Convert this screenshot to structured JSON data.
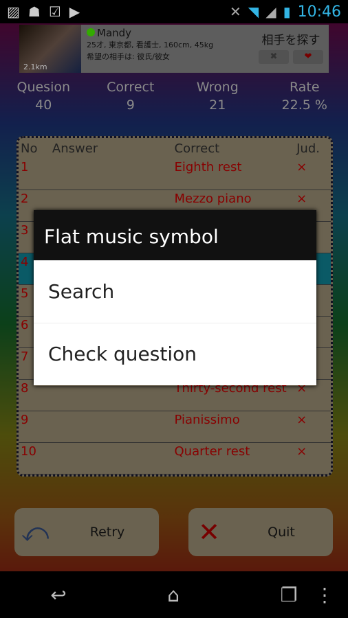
{
  "status_bar": {
    "time": "10:46",
    "icons": [
      "picture-icon",
      "android-icon",
      "clipboard-check-icon",
      "play-store-icon",
      "mute-icon",
      "wifi-icon",
      "signal-icon",
      "battery-icon"
    ]
  },
  "ad": {
    "distance": "2.1km",
    "name": "Mandy",
    "details": "25才, 東京都, 看護士, 160cm, 45kg",
    "wish": "希望の相手は: 彼氏/彼女",
    "search_label": "相手を探す",
    "reject": "✖",
    "like": "❤"
  },
  "stats": [
    {
      "label": "Quesion",
      "value": "40"
    },
    {
      "label": "Correct",
      "value": "9"
    },
    {
      "label": "Wrong",
      "value": "21"
    },
    {
      "label": "Rate",
      "value": "22.5 %"
    }
  ],
  "table": {
    "headers": [
      "No",
      "Answer",
      "Correct",
      "Jud."
    ],
    "rows": [
      {
        "no": "1",
        "answer": "",
        "correct": "Eighth rest",
        "jud": "×"
      },
      {
        "no": "2",
        "answer": "",
        "correct": "Mezzo piano",
        "jud": "×"
      },
      {
        "no": "3",
        "answer": "",
        "correct": "",
        "jud": "×"
      },
      {
        "no": "4",
        "answer": "",
        "correct": "",
        "jud": ""
      },
      {
        "no": "5",
        "answer": "",
        "correct": "",
        "jud": ""
      },
      {
        "no": "6",
        "answer": "",
        "correct": "",
        "jud": ""
      },
      {
        "no": "7",
        "answer": "",
        "correct": "",
        "jud": ""
      },
      {
        "no": "8",
        "answer": "",
        "correct": "Thirty-second rest",
        "jud": "×"
      },
      {
        "no": "9",
        "answer": "",
        "correct": "Pianissimo",
        "jud": "×"
      },
      {
        "no": "10",
        "answer": "",
        "correct": "Quarter rest",
        "jud": "×"
      }
    ]
  },
  "buttons": {
    "retry": "Retry",
    "quit": "Quit"
  },
  "dialog": {
    "title": "Flat music symbol",
    "items": [
      "Search",
      "Check question"
    ]
  }
}
